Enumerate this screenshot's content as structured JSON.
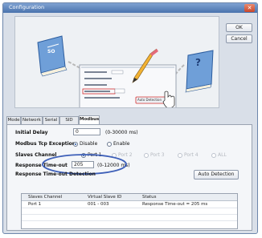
{
  "window": {
    "title": "Configuration",
    "close_glyph": "✕"
  },
  "buttons": {
    "ok": "OK",
    "cancel": "Cancel",
    "auto_detection": "Auto Detection"
  },
  "illustration": {
    "left_book_text": "SO",
    "right_book_text": "?",
    "mini_dialog_button": "Auto Detection"
  },
  "tabs": [
    "Mode",
    "Network",
    "Serial",
    "SID Map",
    "Modbus"
  ],
  "active_tab": "Modbus",
  "modbus": {
    "initial_delay": {
      "label": "Initial Delay",
      "value": "0",
      "unit": "(0-30000 ms)"
    },
    "tcp_exception": {
      "label": "Modbus Tcp Exception",
      "options": [
        "Disable",
        "Enable"
      ],
      "selected": "Disable"
    },
    "slaves_channel": {
      "label": "Slaves Channel",
      "options": [
        "Port 1",
        "Port 2",
        "Port 3",
        "Port 4",
        "ALL"
      ],
      "selected": "Port 1"
    },
    "response_timeout": {
      "label": "Response Time-out",
      "value": "205",
      "unit": "(0-12000 ms)"
    },
    "response_timeout_detection": {
      "label": "Response Time-out Detection"
    }
  },
  "table": {
    "columns": [
      "Slaves Channel",
      "Virtual Slave ID",
      "Status"
    ],
    "rows": [
      [
        "Port 1",
        "001 - 003",
        "Response Time-out = 205 ms"
      ]
    ]
  },
  "colors": {
    "annotation_circle": "#3d5fb8",
    "titlebar": "#4a73ad"
  }
}
